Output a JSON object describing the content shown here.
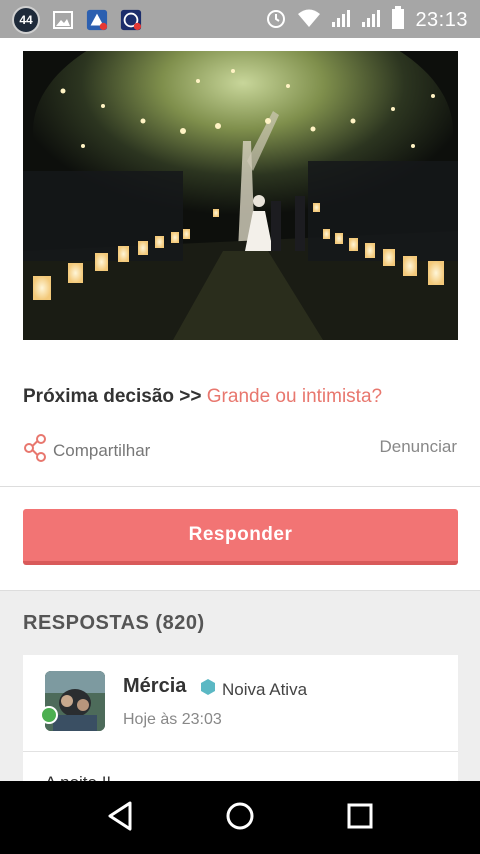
{
  "status_bar": {
    "notification_count": "44",
    "time": "23:13"
  },
  "post": {
    "next_decision_label": "Próxima decisão >>",
    "next_decision_link": "Grande ou intimista?",
    "share_label": "Compartilhar",
    "report_label": "Denunciar",
    "respond_button": "Responder"
  },
  "answers": {
    "title": "RESPOSTAS (820)",
    "items": [
      {
        "author": "Mércia",
        "badge": "Noiva Ativa",
        "time": "Hoje às 23:03",
        "text": "A noite !!"
      }
    ]
  },
  "colors": {
    "accent": "#f27474",
    "link": "#e8776e",
    "online": "#4caf50",
    "badge_icon": "#5bb8c4"
  },
  "icons": {
    "share": "share-icon",
    "back": "back-icon",
    "home": "home-icon",
    "recents": "recents-icon"
  }
}
